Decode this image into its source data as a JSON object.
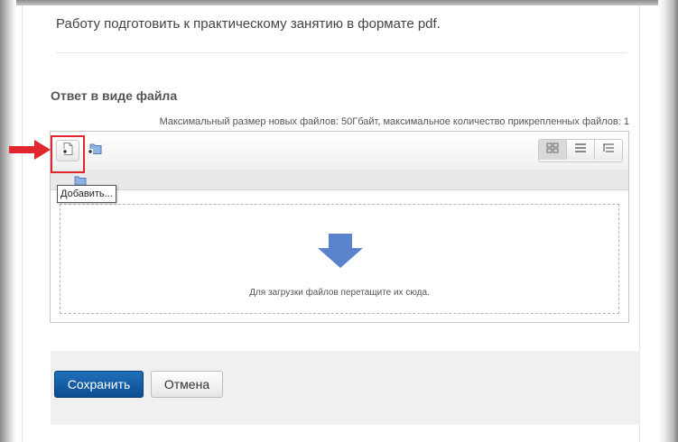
{
  "assignment": {
    "description": "Работу подготовить к практическому занятию в формате pdf."
  },
  "file_submission": {
    "title": "Ответ в виде файла",
    "limits": "Максимальный размер новых файлов: 50Гбайт, максимальное количество прикрепленных файлов: 1",
    "toolbar": {
      "add_file_icon": "add-file-icon",
      "create_folder_icon": "create-folder-icon",
      "view_icons": [
        "grid-view-icon",
        "list-view-icon",
        "tree-view-icon"
      ],
      "add_tooltip": "Добавить..."
    },
    "dropzone": {
      "icon": "down-arrow-icon",
      "text": "Для загрузки файлов перетащите их сюда."
    }
  },
  "actions": {
    "save_label": "Сохранить",
    "cancel_label": "Отмена"
  },
  "colors": {
    "primary_button": "#0f5aa3",
    "annotation_red": "#e2262e",
    "drop_arrow": "#5a83cc"
  }
}
